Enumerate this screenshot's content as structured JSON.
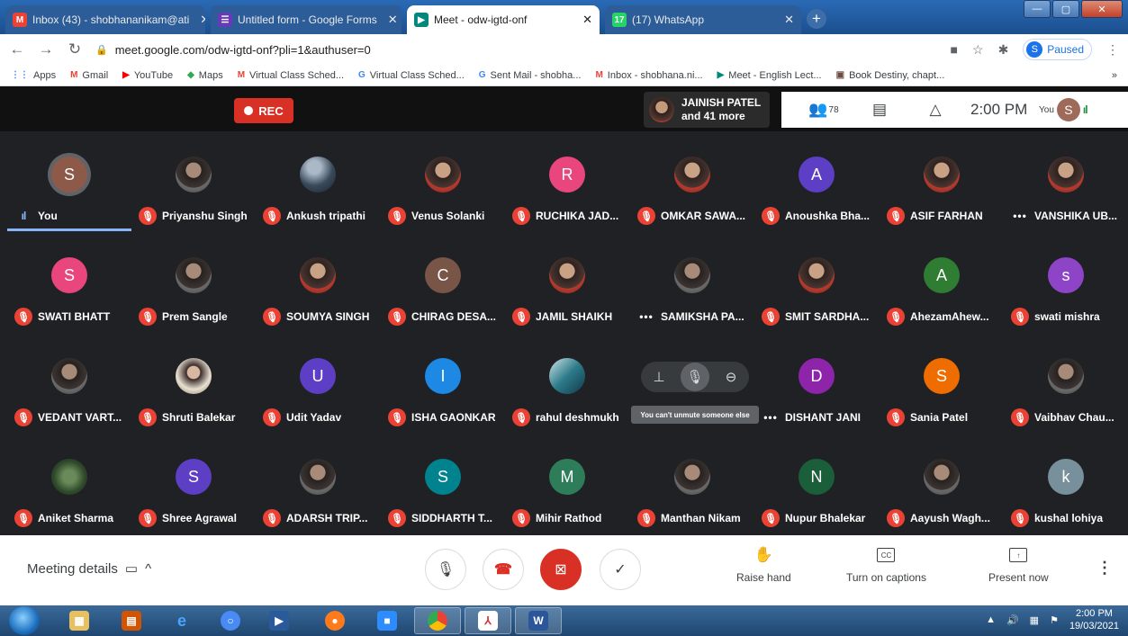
{
  "browser": {
    "tabs": [
      {
        "title": "Inbox (43) - shobhananikam@ati",
        "icon": "M",
        "icon_color": "#ea4335",
        "active": false
      },
      {
        "title": "Untitled form - Google Forms",
        "icon": "☰",
        "icon_color": "#673ab7",
        "active": false
      },
      {
        "title": "Meet - odw-igtd-onf",
        "icon": "▶",
        "icon_color": "#00897b",
        "active": true
      },
      {
        "title": "(17) WhatsApp",
        "icon": "17",
        "icon_color": "#25d366",
        "active": false
      }
    ],
    "url": "meet.google.com/odw-igtd-onf?pli=1&authuser=0",
    "profile_initial": "S",
    "profile_status": "Paused",
    "bookmarks": [
      {
        "label": "Apps",
        "icon": "⋮⋮",
        "color": "#4285f4"
      },
      {
        "label": "Gmail",
        "icon": "M",
        "color": "#ea4335"
      },
      {
        "label": "YouTube",
        "icon": "▶",
        "color": "#ff0000"
      },
      {
        "label": "Maps",
        "icon": "◆",
        "color": "#34a853"
      },
      {
        "label": "Virtual Class Sched...",
        "icon": "M",
        "color": "#ea4335"
      },
      {
        "label": "Virtual Class Sched...",
        "icon": "G",
        "color": "#4285f4"
      },
      {
        "label": "Sent Mail - shobha...",
        "icon": "G",
        "color": "#4285f4"
      },
      {
        "label": "Inbox - shobhana.ni...",
        "icon": "M",
        "color": "#ea4335"
      },
      {
        "label": "Meet - English Lect...",
        "icon": "▶",
        "color": "#00897b"
      },
      {
        "label": "Book Destiny, chapt...",
        "icon": "▣",
        "color": "#6d4c41"
      }
    ],
    "bookmarks_overflow": "»"
  },
  "meet": {
    "rec_label": "REC",
    "speaker_line1": "JAINISH PATEL",
    "speaker_line2": "and 41 more",
    "people_count": "78",
    "time": "2:00 PM",
    "you_label": "You",
    "you_initial": "S",
    "participants": [
      {
        "name": "You",
        "initial": "S",
        "color": "#8d5a4a",
        "kind": "letter",
        "status": "speaking"
      },
      {
        "name": "Priyanshu Singh",
        "kind": "photo2",
        "status": "muted"
      },
      {
        "name": "Ankush tripathi",
        "kind": "scene",
        "status": "muted"
      },
      {
        "name": "Venus Solanki",
        "kind": "photo",
        "status": "muted"
      },
      {
        "name": "RUCHIKA JAD...",
        "initial": "R",
        "color": "#e8467c",
        "kind": "letter",
        "status": "muted"
      },
      {
        "name": "OMKAR SAWA...",
        "kind": "photo",
        "status": "muted"
      },
      {
        "name": "Anoushka Bha...",
        "initial": "A",
        "color": "#5c3fc4",
        "kind": "letter",
        "status": "muted"
      },
      {
        "name": "ASIF FARHAN",
        "kind": "photo",
        "status": "muted"
      },
      {
        "name": "VANSHIKA UB...",
        "kind": "photo",
        "status": "dots"
      },
      {
        "name": "SWATI BHATT",
        "initial": "S",
        "color": "#e8467c",
        "kind": "letter",
        "status": "muted"
      },
      {
        "name": "Prem Sangle",
        "kind": "photo2",
        "status": "muted"
      },
      {
        "name": "SOUMYA SINGH",
        "kind": "photo",
        "status": "muted"
      },
      {
        "name": "CHIRAG DESA...",
        "initial": "C",
        "color": "#795548",
        "kind": "letter",
        "status": "muted"
      },
      {
        "name": "JAMIL SHAIKH",
        "kind": "photo",
        "status": "muted"
      },
      {
        "name": "SAMIKSHA PA...",
        "kind": "photo2",
        "status": "dots"
      },
      {
        "name": "SMIT SARDHA...",
        "kind": "photo",
        "status": "muted"
      },
      {
        "name": "AhezamAhew...",
        "initial": "A",
        "color": "#2e7d32",
        "kind": "letter",
        "status": "muted"
      },
      {
        "name": "swati mishra",
        "initial": "s",
        "color": "#8e44c7",
        "kind": "letter",
        "status": "muted"
      },
      {
        "name": "VEDANT VART...",
        "kind": "photo2",
        "status": "muted"
      },
      {
        "name": "Shruti Balekar",
        "kind": "girl",
        "status": "muted"
      },
      {
        "name": "Udit Yadav",
        "initial": "U",
        "color": "#5c3fc4",
        "kind": "letter",
        "status": "muted"
      },
      {
        "name": "ISHA GAONKAR",
        "initial": "I",
        "color": "#1e88e5",
        "kind": "letter",
        "status": "muted"
      },
      {
        "name": "rahul deshmukh",
        "kind": "ocean",
        "status": "muted"
      },
      {
        "name": "",
        "kind": "none",
        "status": "hover"
      },
      {
        "name": "DISHANT JANI",
        "initial": "D",
        "color": "#8e24aa",
        "kind": "letter",
        "status": "dots"
      },
      {
        "name": "Sania Patel",
        "initial": "S",
        "color": "#ef6c00",
        "kind": "letter",
        "status": "muted"
      },
      {
        "name": "Vaibhav Chau...",
        "kind": "photo2",
        "status": "muted"
      },
      {
        "name": "Aniket Sharma",
        "kind": "nature",
        "status": "muted"
      },
      {
        "name": "Shree Agrawal",
        "initial": "S",
        "color": "#5c3fc4",
        "kind": "letter",
        "status": "muted"
      },
      {
        "name": "ADARSH TRIP...",
        "kind": "photo2",
        "status": "muted"
      },
      {
        "name": "SIDDHARTH T...",
        "initial": "S",
        "color": "#00838f",
        "kind": "letter",
        "status": "muted"
      },
      {
        "name": "Mihir Rathod",
        "initial": "M",
        "color": "#2e7d5a",
        "kind": "letter",
        "status": "muted"
      },
      {
        "name": "Manthan Nikam",
        "kind": "photo2",
        "status": "muted"
      },
      {
        "name": "Nupur Bhalekar",
        "initial": "N",
        "color": "#1b5e3a",
        "kind": "letter",
        "status": "muted"
      },
      {
        "name": "Aayush Wagh...",
        "kind": "photo2",
        "status": "muted"
      },
      {
        "name": "kushal lohiya",
        "initial": "k",
        "color": "#78909c",
        "kind": "letter",
        "status": "muted"
      }
    ],
    "tooltip": "You can't unmute someone else",
    "meeting_details": "Meeting details",
    "raise_hand": "Raise hand",
    "captions": "Turn on captions",
    "present": "Present now"
  },
  "taskbar": {
    "time": "2:00 PM",
    "date": "19/03/2021"
  }
}
